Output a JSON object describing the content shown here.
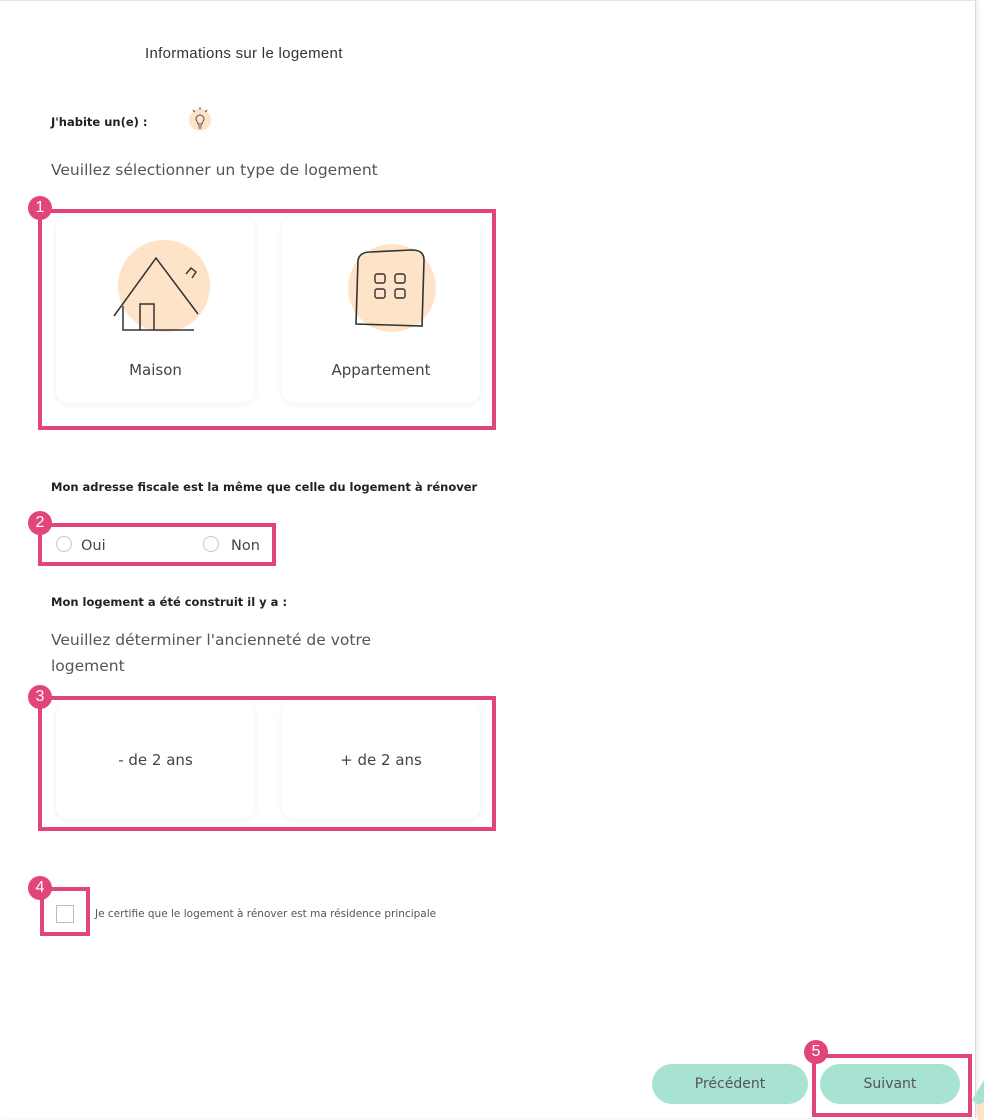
{
  "form": {
    "title": "Informations sur le logement",
    "housing_label": "J'habite un(e) :",
    "housing_hint": "Veuillez sélectionner un type de logement",
    "housing_options": [
      "Maison",
      "Appartement"
    ],
    "fiscal_label": "Mon adresse fiscale est la même que celle du logement à rénover",
    "fiscal_options": [
      "Oui",
      "Non"
    ],
    "age_label": "Mon logement a été construit il y a :",
    "age_hint": "Veuillez déterminer l'ancienneté de votre logement",
    "age_options": [
      "- de 2 ans",
      "+ de 2 ans"
    ],
    "certify_text": "Je certifie que le logement à rénover est ma résidence principale"
  },
  "buttons": {
    "previous": "Précédent",
    "next": "Suivant"
  },
  "annotations": [
    "1",
    "2",
    "3",
    "4",
    "5"
  ],
  "colors": {
    "highlight": "#e2457a",
    "button_bg": "#a8e2d2",
    "icon_blob": "#fde3c8"
  },
  "icons": {
    "tip": "lightbulb-icon",
    "house": "house-icon",
    "apartment": "apartment-building-icon"
  }
}
